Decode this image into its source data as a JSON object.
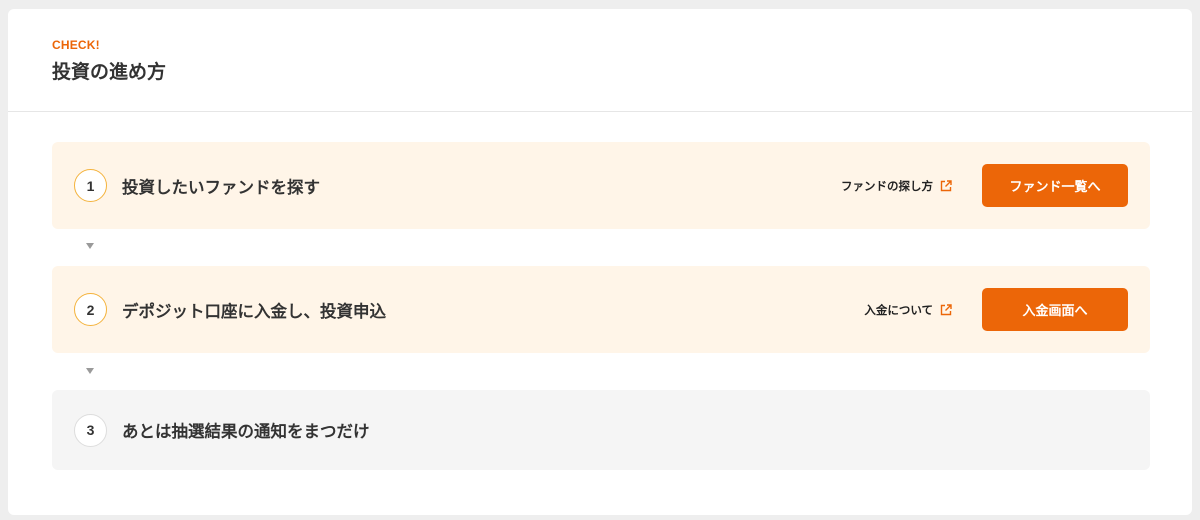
{
  "header": {
    "eyebrow": "CHECK!",
    "title": "投資の進め方"
  },
  "steps": [
    {
      "number": "1",
      "title": "投資したいファンドを探す",
      "help_link": "ファンドの探し方",
      "button": "ファンド一覧へ",
      "state": "active"
    },
    {
      "number": "2",
      "title": "デポジット口座に入金し、投資申込",
      "help_link": "入金について",
      "button": "入金画面へ",
      "state": "active"
    },
    {
      "number": "3",
      "title": "あとは抽選結果の通知をまつだけ",
      "state": "inactive"
    }
  ],
  "icons": {
    "external_link": "external-link-icon",
    "step_connector": "down-triangle-icon"
  },
  "colors": {
    "accent": "#ec6608",
    "active_step_bg": "#fff5e8",
    "inactive_step_bg": "#f5f5f5",
    "active_number_ring": "#f4b33d",
    "inactive_number_ring": "#dddddd"
  }
}
